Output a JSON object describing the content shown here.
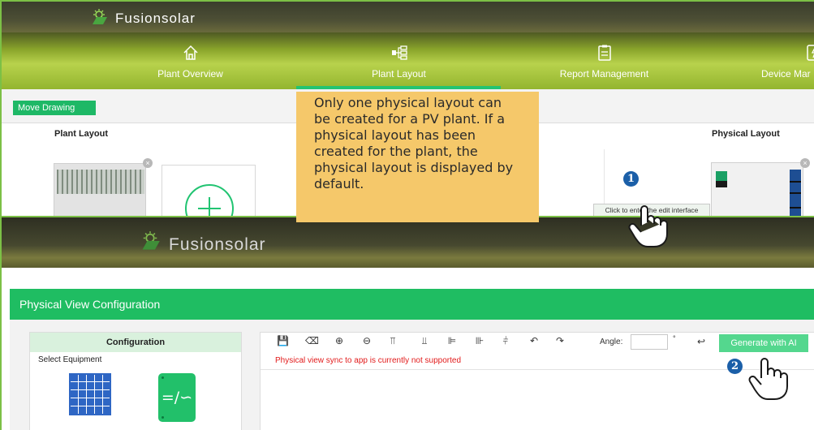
{
  "top": {
    "app_name": "Fusionsolar",
    "nav": [
      {
        "label": "Plant Overview",
        "icon": "home-icon"
      },
      {
        "label": "Plant Layout",
        "icon": "layout-tree-icon",
        "active": true
      },
      {
        "label": "Report Management",
        "icon": "clipboard-icon"
      },
      {
        "label": "Device Mar",
        "icon": "device-icon"
      }
    ],
    "move_drawing_label": "Move Drawing",
    "plant_layout_title": "Plant Layout",
    "physical_layout_title": "Physical Layout",
    "edit_tooltip": "Click to enter the edit interface",
    "close_glyph": "×"
  },
  "callout_text": "Only one physical layout can be created for a PV plant. If a physical layout has been created for the plant, the physical layout is displayed by default.",
  "steps": [
    "1",
    "2"
  ],
  "bottom": {
    "app_name": "Fusionsolar",
    "dialog_title": "Physical View Configuration",
    "config_title": "Configuration",
    "select_equipment_label": "Select Equipment",
    "inverter_glyph": "=/∽",
    "angle_label": "Angle:",
    "angle_value": "",
    "degree_symbol": "°",
    "generate_ai_label": "Generate with AI",
    "warning_text": "Physical view sync to app is currently not supported",
    "tools": [
      {
        "name": "save-icon",
        "glyph": "💾"
      },
      {
        "name": "eraser-icon",
        "glyph": "⌫"
      },
      {
        "name": "zoom-in-icon",
        "glyph": "⊕"
      },
      {
        "name": "zoom-out-icon",
        "glyph": "⊖"
      },
      {
        "name": "align-top-icon",
        "glyph": "⫪"
      },
      {
        "name": "align-bottom-icon",
        "glyph": "⫫"
      },
      {
        "name": "align-left-icon",
        "glyph": "⊫"
      },
      {
        "name": "align-right-icon",
        "glyph": "⊪"
      },
      {
        "name": "align-center-icon",
        "glyph": "⫩"
      },
      {
        "name": "undo-icon",
        "glyph": "↶"
      },
      {
        "name": "redo-icon",
        "glyph": "↷"
      }
    ],
    "reset-angle-icon": "↩"
  },
  "colors": {
    "brand_green": "#1fbd62",
    "frame_green": "#7cc046",
    "callout_bg": "#f5c86a",
    "step_blue": "#1b5fa8",
    "warning_red": "#e21b1b"
  }
}
